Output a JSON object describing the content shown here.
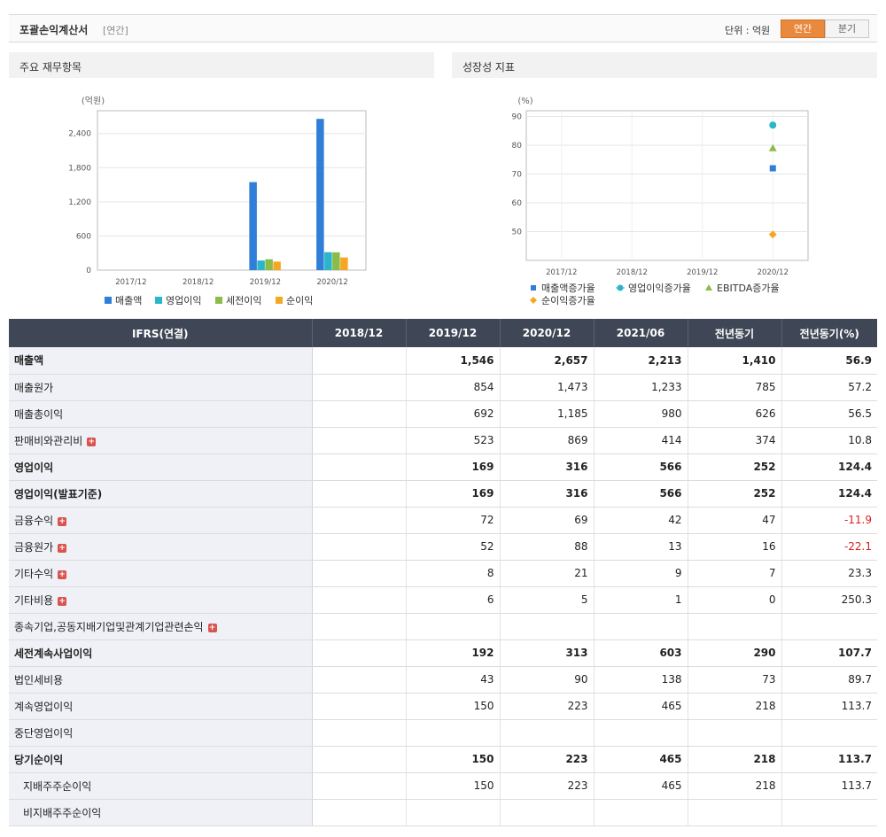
{
  "header": {
    "title": "포괄손익계산서",
    "subtitle": "[연간]",
    "unit_label": "단위 : 억원",
    "toggle_annual": "연간",
    "toggle_quarter": "분기"
  },
  "colors": {
    "accent": "#e8893e",
    "table_header_bg": "#3f4756",
    "negative": "#d81f1f",
    "series": [
      "#2f7ed8",
      "#2bb5c8",
      "#8bbc49",
      "#f5a623"
    ]
  },
  "panels": {
    "left_title": "주요 재무항목",
    "right_title": "성장성 지표"
  },
  "chart_data": [
    {
      "type": "bar",
      "unit": "(억원)",
      "categories": [
        "2017/12",
        "2018/12",
        "2019/12",
        "2020/12"
      ],
      "ylim": [
        0,
        2800
      ],
      "yticks": [
        0,
        600,
        1200,
        1800,
        2400
      ],
      "ytick_labels": [
        "0",
        "600",
        "1,200",
        "1,800",
        "2,400"
      ],
      "series": [
        {
          "name": "매출액",
          "color": "#2f7ed8",
          "values": [
            null,
            null,
            1546,
            2657
          ]
        },
        {
          "name": "영업이익",
          "color": "#2bb5c8",
          "values": [
            null,
            null,
            169,
            316
          ]
        },
        {
          "name": "세전이익",
          "color": "#8bbc49",
          "values": [
            null,
            null,
            192,
            313
          ]
        },
        {
          "name": "순이익",
          "color": "#f5a623",
          "values": [
            null,
            null,
            150,
            223
          ]
        }
      ],
      "grid": true,
      "legend": "bottom"
    },
    {
      "type": "scatter",
      "unit": "(%)",
      "categories": [
        "2017/12",
        "2018/12",
        "2019/12",
        "2020/12"
      ],
      "ylim": [
        40,
        92
      ],
      "yticks": [
        50,
        60,
        70,
        80,
        90
      ],
      "ytick_labels": [
        "50",
        "60",
        "70",
        "80",
        "90"
      ],
      "series": [
        {
          "name": "매출액증가율",
          "color": "#2f7ed8",
          "marker": "square",
          "values": [
            null,
            null,
            null,
            72
          ]
        },
        {
          "name": "영업이익증가율",
          "color": "#2bb5c8",
          "marker": "circle",
          "values": [
            null,
            null,
            null,
            87
          ]
        },
        {
          "name": "EBITDA증가율",
          "color": "#8bbc49",
          "marker": "triangle",
          "values": [
            null,
            null,
            null,
            79
          ]
        },
        {
          "name": "순이익증가율",
          "color": "#f5a623",
          "marker": "diamond",
          "values": [
            null,
            null,
            null,
            49
          ]
        }
      ],
      "grid": true,
      "legend": "bottom"
    }
  ],
  "table": {
    "columns": [
      "IFRS(연결)",
      "2018/12",
      "2019/12",
      "2020/12",
      "2021/06",
      "전년동기",
      "전년동기(%)"
    ],
    "rows": [
      {
        "label": "매출액",
        "expand": false,
        "bold": true,
        "indent": false,
        "cells": [
          "",
          "1,546",
          "2,657",
          "2,213",
          "1,410",
          "56.9"
        ],
        "neg": false
      },
      {
        "label": "매출원가",
        "expand": false,
        "bold": false,
        "indent": false,
        "cells": [
          "",
          "854",
          "1,473",
          "1,233",
          "785",
          "57.2"
        ],
        "neg": false
      },
      {
        "label": "매출총이익",
        "expand": false,
        "bold": false,
        "indent": false,
        "cells": [
          "",
          "692",
          "1,185",
          "980",
          "626",
          "56.5"
        ],
        "neg": false
      },
      {
        "label": "판매비와관리비",
        "expand": true,
        "bold": false,
        "indent": false,
        "cells": [
          "",
          "523",
          "869",
          "414",
          "374",
          "10.8"
        ],
        "neg": false
      },
      {
        "label": "영업이익",
        "expand": false,
        "bold": true,
        "indent": false,
        "cells": [
          "",
          "169",
          "316",
          "566",
          "252",
          "124.4"
        ],
        "neg": false
      },
      {
        "label": "영업이익(발표기준)",
        "expand": false,
        "bold": true,
        "indent": false,
        "cells": [
          "",
          "169",
          "316",
          "566",
          "252",
          "124.4"
        ],
        "neg": false
      },
      {
        "label": "금융수익",
        "expand": true,
        "bold": false,
        "indent": false,
        "cells": [
          "",
          "72",
          "69",
          "42",
          "47",
          "-11.9"
        ],
        "neg": true
      },
      {
        "label": "금융원가",
        "expand": true,
        "bold": false,
        "indent": false,
        "cells": [
          "",
          "52",
          "88",
          "13",
          "16",
          "-22.1"
        ],
        "neg": true
      },
      {
        "label": "기타수익",
        "expand": true,
        "bold": false,
        "indent": false,
        "cells": [
          "",
          "8",
          "21",
          "9",
          "7",
          "23.3"
        ],
        "neg": false
      },
      {
        "label": "기타비용",
        "expand": true,
        "bold": false,
        "indent": false,
        "cells": [
          "",
          "6",
          "5",
          "1",
          "0",
          "250.3"
        ],
        "neg": false
      },
      {
        "label": "종속기업,공동지배기업및관계기업관련손익",
        "expand": true,
        "bold": false,
        "indent": false,
        "cells": [
          "",
          "",
          "",
          "",
          "",
          ""
        ],
        "neg": false
      },
      {
        "label": "세전계속사업이익",
        "expand": false,
        "bold": true,
        "indent": false,
        "cells": [
          "",
          "192",
          "313",
          "603",
          "290",
          "107.7"
        ],
        "neg": false
      },
      {
        "label": "법인세비용",
        "expand": false,
        "bold": false,
        "indent": false,
        "cells": [
          "",
          "43",
          "90",
          "138",
          "73",
          "89.7"
        ],
        "neg": false
      },
      {
        "label": "계속영업이익",
        "expand": false,
        "bold": false,
        "indent": false,
        "cells": [
          "",
          "150",
          "223",
          "465",
          "218",
          "113.7"
        ],
        "neg": false
      },
      {
        "label": "중단영업이익",
        "expand": false,
        "bold": false,
        "indent": false,
        "cells": [
          "",
          "",
          "",
          "",
          "",
          ""
        ],
        "neg": false
      },
      {
        "label": "당기순이익",
        "expand": false,
        "bold": true,
        "indent": false,
        "cells": [
          "",
          "150",
          "223",
          "465",
          "218",
          "113.7"
        ],
        "neg": false
      },
      {
        "label": "지배주주순이익",
        "expand": false,
        "bold": false,
        "indent": true,
        "cells": [
          "",
          "150",
          "223",
          "465",
          "218",
          "113.7"
        ],
        "neg": false
      },
      {
        "label": "비지배주주순이익",
        "expand": false,
        "bold": false,
        "indent": true,
        "cells": [
          "",
          "",
          "",
          "",
          "",
          ""
        ],
        "neg": false
      }
    ]
  }
}
